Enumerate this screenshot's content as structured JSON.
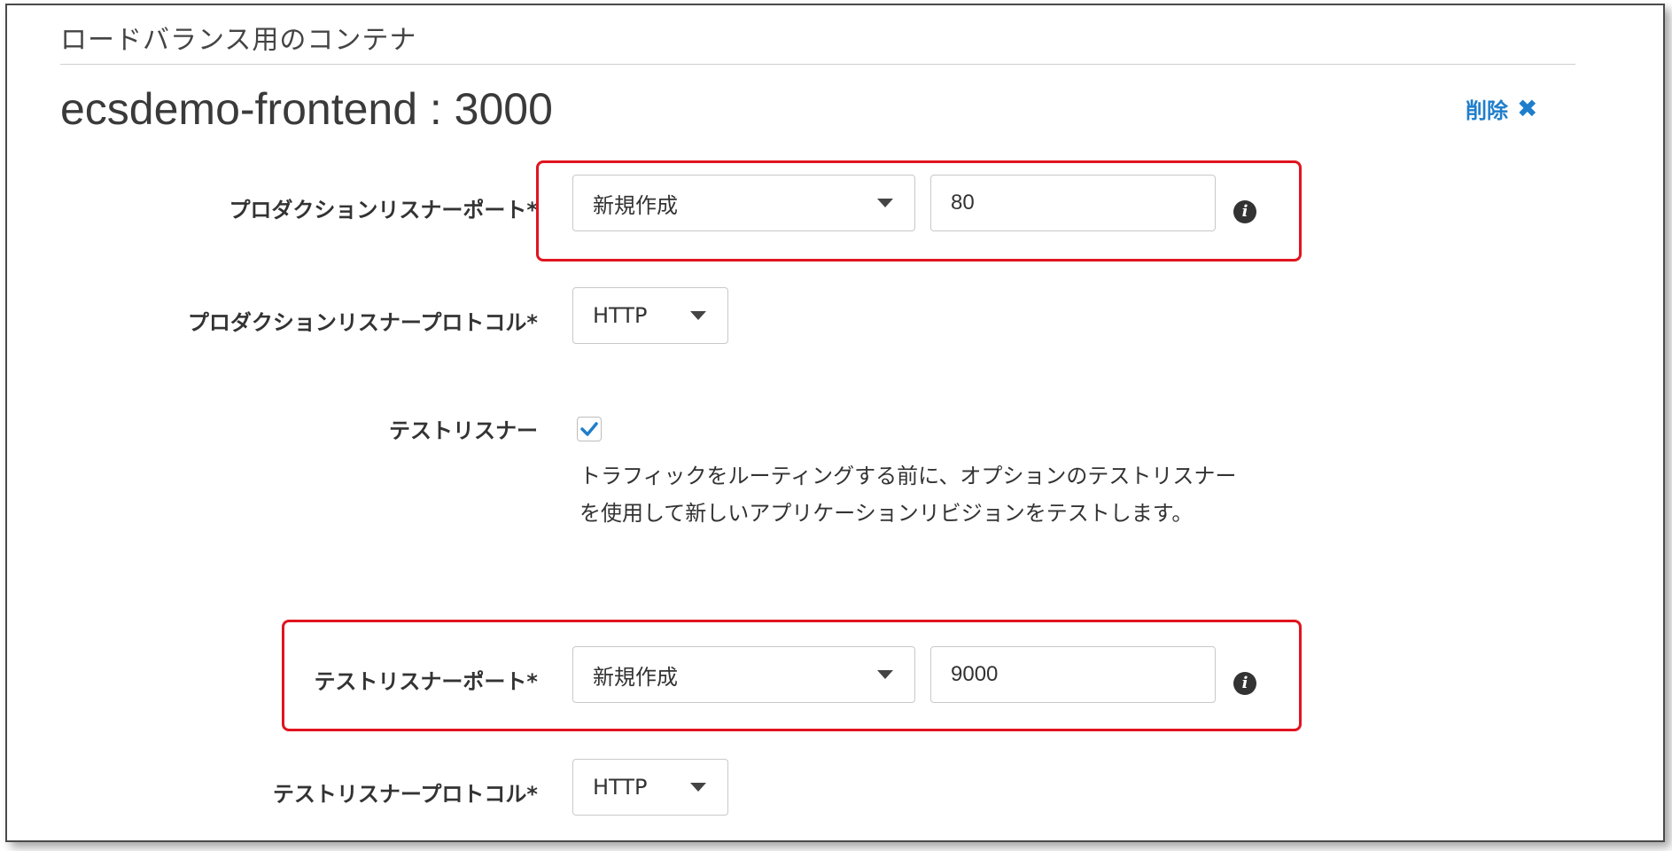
{
  "section": {
    "title": "ロードバランス用のコンテナ"
  },
  "container": {
    "name": "ecsdemo-frontend : 3000"
  },
  "delete": {
    "label": "削除",
    "icon": "close-icon"
  },
  "production_listener_port": {
    "label": "プロダクションリスナーポート*",
    "select_value": "新規作成",
    "port_value": "80"
  },
  "production_listener_protocol": {
    "label": "プロダクションリスナープロトコル*",
    "select_value": "HTTP"
  },
  "test_listener": {
    "label": "テストリスナー",
    "checked": true,
    "help_text": "トラフィックをルーティングする前に、オプションのテストリスナーを使用して新しいアプリケーションリビジョンをテストします。"
  },
  "test_listener_port": {
    "label": "テストリスナーポート*",
    "select_value": "新規作成",
    "port_value": "9000"
  },
  "test_listener_protocol": {
    "label": "テストリスナープロトコル*",
    "select_value": "HTTP"
  },
  "colors": {
    "highlight": "#e0141e",
    "link": "#1f7ecb",
    "checkbox_check": "#1f7ecb"
  }
}
